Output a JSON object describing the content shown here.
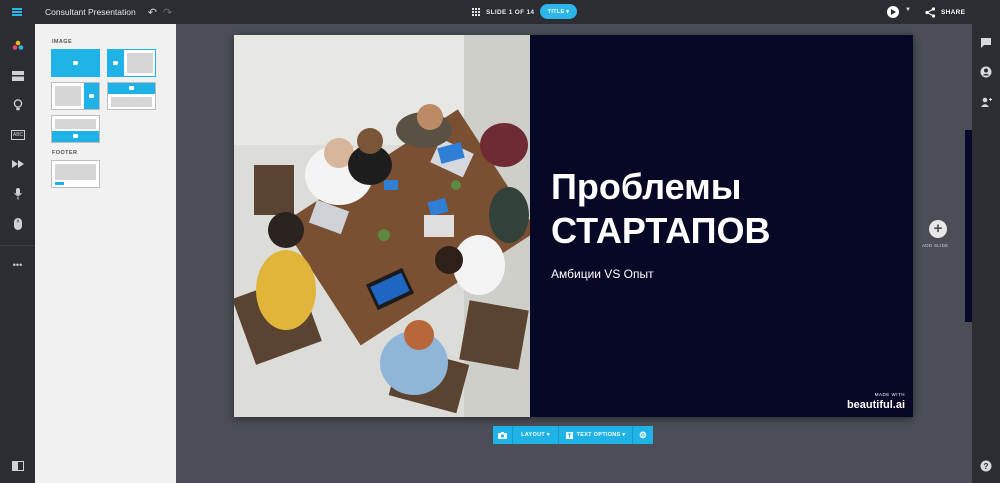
{
  "topbar": {
    "doc_title": "Consultant Presentation",
    "slide_counter": "SLIDE 1 OF 14",
    "title_pill": "TITLE",
    "share_label": "SHARE",
    "accent": "#2cb6e8"
  },
  "left_rail": {
    "icons": [
      "menu-icon",
      "colors-icon",
      "layout-icon",
      "lightbulb-icon",
      "abc-icon",
      "fast-forward-icon",
      "microphone-icon",
      "mouse-icon",
      "more-icon",
      "panel-toggle-icon"
    ],
    "abc_label": "ABC"
  },
  "layout_panel": {
    "image_heading": "IMAGE",
    "footer_heading": "FOOTER"
  },
  "slide": {
    "title_line1": "Проблемы",
    "title_line2": "СТАРТАПОВ",
    "subtitle": "Амбиции VS Опыт",
    "made_with": "MADE WITH",
    "brand": "beautiful.ai",
    "background": "#070726"
  },
  "add_slide_label": "ADD SLIDE",
  "slide_toolbar": {
    "layout_label": "LAYOUT",
    "text_options_label": "TEXT OPTIONS"
  }
}
